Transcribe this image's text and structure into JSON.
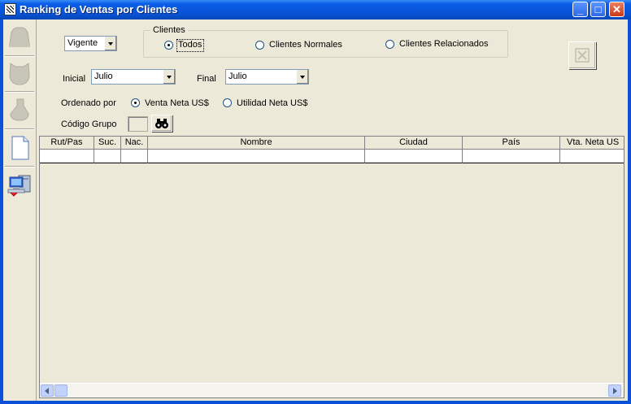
{
  "window": {
    "title": "Ranking de Ventas por Clientes"
  },
  "filters": {
    "status_combo": "Vigente",
    "clients_group": {
      "legend": "Clientes",
      "options": [
        "Todos",
        "Clientes Normales",
        "Clientes Relacionados"
      ],
      "selected": "Todos"
    },
    "inicial_label": "Inicial",
    "inicial_value": "Julio",
    "final_label": "Final",
    "final_value": "Julio",
    "order_label": "Ordenado por",
    "order_options": [
      "Venta Neta US$",
      "Utilidad Neta US$"
    ],
    "order_selected": "Venta Neta US$",
    "group_code_label": "Código Grupo",
    "group_code_value": ""
  },
  "grid": {
    "columns": [
      "Rut/Pas",
      "Suc.",
      "Nac.",
      "Nombre",
      "Ciudad",
      "País",
      "Vta. Neta US"
    ],
    "rows": []
  },
  "toolbar": {
    "icons": [
      "disabled-tool-1-icon",
      "disabled-tool-2-icon",
      "disabled-tool-3-icon",
      "new-document-icon",
      "computer-network-icon"
    ]
  }
}
